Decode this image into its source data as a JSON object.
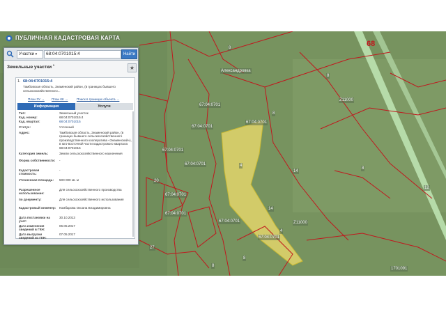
{
  "header": {
    "title": "ПУБЛИЧНАЯ КАДАСТРОВАЯ КАРТА"
  },
  "region_number": "68",
  "search": {
    "type_label": "Участки",
    "value": "68:04:0701015:4",
    "button_label": "Найти"
  },
  "section": {
    "title": "Земельные участки",
    "count": "1"
  },
  "result": {
    "index": "1.",
    "id": "68:04:0701015:4",
    "description": "Тамбовская область, Знаменский район, (в границах бывшего сельскохозяйственного...",
    "links": [
      "План ЗУ →",
      "План КК →",
      "Поиск в границах объекта →"
    ]
  },
  "tabs": {
    "info": "Информация",
    "services": "Услуги"
  },
  "properties": [
    {
      "k": "Тип:",
      "v": "Земельный участок"
    },
    {
      "k": "Кад. номер:",
      "v": "68:04:0701015:4"
    },
    {
      "k": "Кад. квартал:",
      "v": "68:04:0701015"
    },
    {
      "k": "Статус:",
      "v": "Учтенный"
    },
    {
      "k": "Адрес:",
      "v": "Тамбовская область, Знаменский район, (в границах бывшего сельскохозяйственного производственного кооператива «Знаменский»), в юго-восточной части кадастрового квартала 68:04:0701015"
    },
    {
      "k": "Категория земель:",
      "v": "Земли сельскохозяйственного назначения"
    },
    {
      "k": "Форма собственности:",
      "v": "-"
    },
    {
      "k": "Кадастровая стоимость:",
      "v": "-"
    },
    {
      "k": "Уточненная площадь:",
      "v": "500 000 кв. м"
    },
    {
      "k": "Разрешенное использование:",
      "v": "Для сельскохозяйственного производства"
    },
    {
      "k": "по документу:",
      "v": "Для сельскохозяйственного использования"
    },
    {
      "k": "Кадастровый инженер:",
      "v": "Комбарова Оксана Владимировна"
    },
    {
      "k": "Дата постановки на учет:",
      "v": "30.10.2013"
    },
    {
      "k": "Дата изменения сведений в ГКН:",
      "v": "06.05.2017"
    },
    {
      "k": "Дата выгрузки сведений из ГКН:",
      "v": "07.05.2017"
    }
  ],
  "map_labels": [
    "67:04:0701",
    "67:04:0701",
    "Александровка",
    "67:04:0701",
    "67:04:0701",
    "67:04:0701",
    "67:04:0701",
    "67:04:0701",
    "67:04:0701",
    "67:04:0701",
    "Z11000",
    "Z11000",
    "1701091",
    "8",
    "8",
    "8",
    "8",
    "8",
    "8",
    "14",
    "12",
    "14",
    "27",
    "4",
    "4",
    "20"
  ],
  "colors": {
    "accent": "#3b79c4",
    "boundary": "#c1171d",
    "highlight": "#e6d86a",
    "road": "#b6e2b0"
  }
}
